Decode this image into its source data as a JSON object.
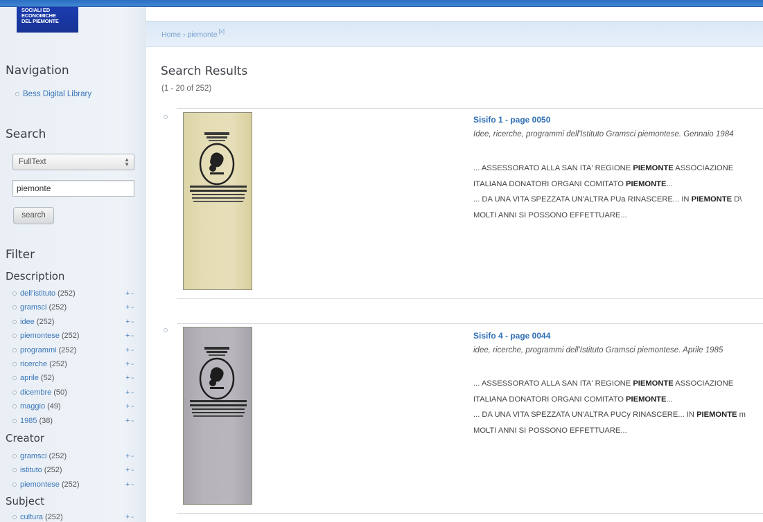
{
  "logo": {
    "lines": [
      "SOCIALI ED",
      "ECONOMICHE",
      "DEL PIEMONTE"
    ]
  },
  "breadcrumb": {
    "home": "Home",
    "separator": "›",
    "current": "piemonte",
    "remove": "[x]"
  },
  "sidebar": {
    "navigation_heading": "Navigation",
    "navigation_link": "Bess Digital Library",
    "search_heading": "Search",
    "search_type": "FullText",
    "search_value": "piemonte",
    "search_button": "search",
    "filter_heading": "Filter",
    "description_heading": "Description",
    "description_facets": [
      {
        "term": "dell'istituto",
        "count": "(252)",
        "pm": "+-"
      },
      {
        "term": "gramsci",
        "count": "(252)",
        "pm": "+-"
      },
      {
        "term": "idee",
        "count": "(252)",
        "pm": "+-"
      },
      {
        "term": "piemontese",
        "count": "(252)",
        "pm": "+-"
      },
      {
        "term": "programmi",
        "count": "(252)",
        "pm": "+-"
      },
      {
        "term": "ricerche",
        "count": "(252)",
        "pm": "+-"
      },
      {
        "term": "aprile",
        "count": "(52)",
        "pm": "+-"
      },
      {
        "term": "dicembre",
        "count": "(50)",
        "pm": "+-"
      },
      {
        "term": "maggio",
        "count": "(49)",
        "pm": "+-"
      },
      {
        "term": "1985",
        "count": "(38)",
        "pm": "+-"
      }
    ],
    "creator_heading": "Creator",
    "creator_facets": [
      {
        "term": "gramsci",
        "count": "(252)",
        "pm": "+-"
      },
      {
        "term": "istituto",
        "count": "(252)",
        "pm": "+-"
      },
      {
        "term": "piemontese",
        "count": "(252)",
        "pm": "+-"
      }
    ],
    "subject_heading": "Subject",
    "subject_facets": [
      {
        "term": "cultura",
        "count": "(252)",
        "pm": "+-"
      }
    ]
  },
  "main": {
    "title": "Search Results",
    "range": "(1 - 20 of 252)",
    "results": [
      {
        "title": "Sisifo 1 - page 0050",
        "description": "Idee, ricerche, programmi dell'Istituto Gramsci piemontese. Gennaio 1984",
        "snippet": [
          [
            {
              "t": "... ASSESSORATO ALLA SAN ITA' REGIONE ",
              "b": false
            },
            {
              "t": "PIEMONTE",
              "b": true
            },
            {
              "t": " ASSOCIAZIONE",
              "b": false
            }
          ],
          [
            {
              "t": "ITALIANA DONATORI ORGANI COMITATO ",
              "b": false
            },
            {
              "t": "PIEMONTE",
              "b": true
            },
            {
              "t": "...",
              "b": false
            }
          ],
          [
            {
              "t": "... DA UNA VITA SPEZZATA UN'ALTRA PUa RINASCERE... IN ",
              "b": false
            },
            {
              "t": "PIEMONTE",
              "b": true
            },
            {
              "t": " D\\",
              "b": false
            }
          ],
          [
            {
              "t": "MOLTI ANNI SI POSSONO EFFETTUARE...",
              "b": false
            }
          ]
        ]
      },
      {
        "title": "Sisifo 4 - page 0044",
        "description": "idee, ricerche, programmi dell'Istituto Gramsci piemontese. Aprile 1985",
        "snippet": [
          [
            {
              "t": "... ASSESSORATO ALLA SAN ITA' REGIONE ",
              "b": false
            },
            {
              "t": "PIEMONTE",
              "b": true
            },
            {
              "t": " ASSOCIAZIONE",
              "b": false
            }
          ],
          [
            {
              "t": "ITALIANA DONATORI ORGANI COMITATO ",
              "b": false
            },
            {
              "t": "PIEMONTE",
              "b": true
            },
            {
              "t": "...",
              "b": false
            }
          ],
          [
            {
              "t": "... DA UNA VITA SPEZZATA UN'ALTRA PUCy RINASCERE... IN ",
              "b": false
            },
            {
              "t": "PIEMONTE",
              "b": true
            },
            {
              "t": " m",
              "b": false
            }
          ],
          [
            {
              "t": "MOLTI ANNI SI POSSONO EFFETTUARE...",
              "b": false
            }
          ]
        ]
      }
    ]
  }
}
